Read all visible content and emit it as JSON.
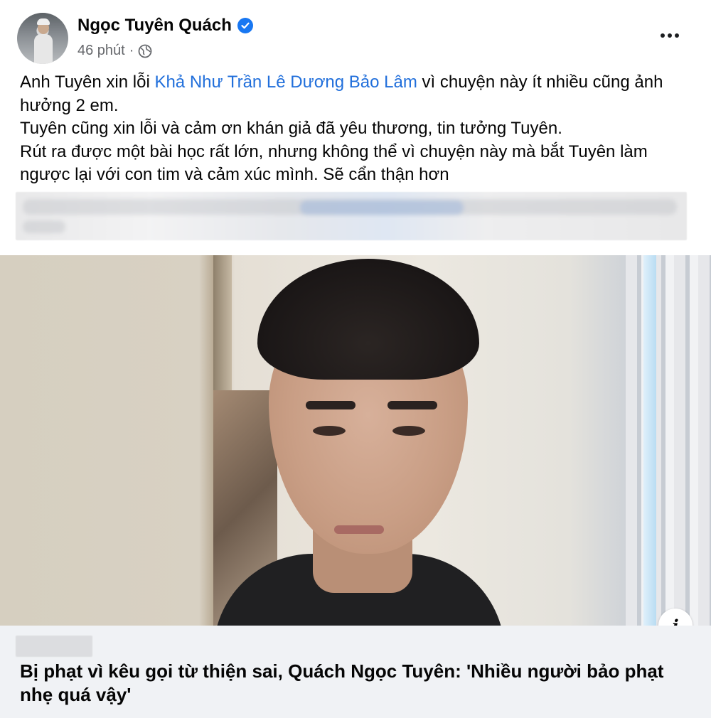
{
  "post": {
    "author": "Ngọc Tuyên Quách",
    "verified_icon": "verified-badge-icon",
    "time": "46 phút",
    "separator": "·",
    "privacy_icon": "globe-icon",
    "more_icon": "more-options-icon",
    "text": {
      "line1_before": "Anh Tuyên xin lỗi ",
      "mention": "Khả Như Trần Lê Dương Bảo Lâm",
      "line1_after": " vì chuyện này ít nhiều cũng ảnh hưởng 2 em.",
      "line2": "Tuyên cũng xin lỗi và cảm ơn khán giả đã yêu thương, tin tưởng Tuyên.",
      "line3": "Rút ra được một bài học rất lớn, nhưng không thể vì chuyện này mà bắt Tuyên làm ngược lại với con tim và cảm xúc mình. Sẽ cẩn thận hơn"
    }
  },
  "link_card": {
    "info_icon": "info-icon",
    "info_glyph": "i",
    "title": "Bị phạt vì kêu gọi từ thiện sai, Quách Ngọc Tuyên: 'Nhiều người bảo phạt nhẹ quá vậy'"
  },
  "colors": {
    "mention": "#216fdb",
    "meta": "#65676b",
    "verified": "#1877f2",
    "link_card_bg": "#f0f2f5"
  }
}
